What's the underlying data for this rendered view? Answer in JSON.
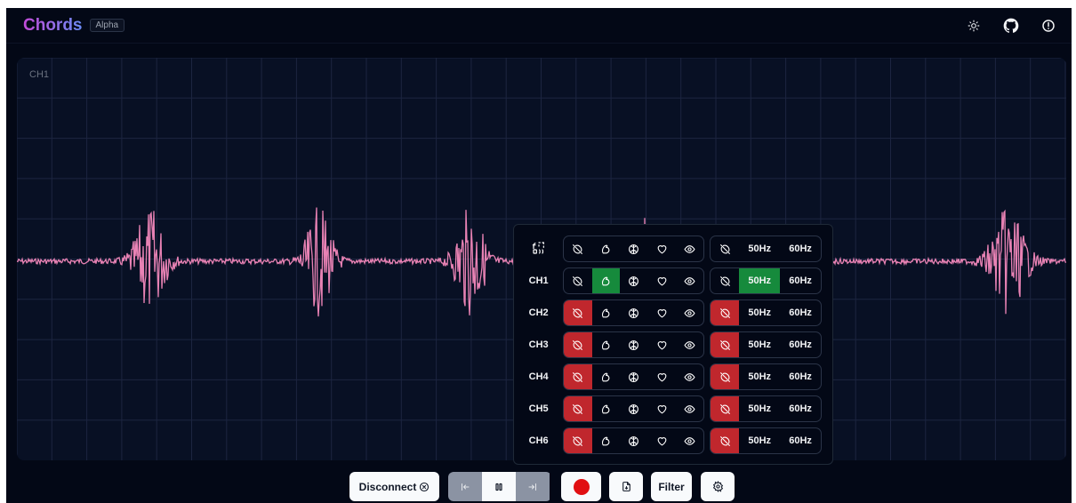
{
  "app": {
    "title": "Chords",
    "badge": "Alpha"
  },
  "header_icons": [
    "sun-icon",
    "github-icon",
    "info-icon"
  ],
  "plot": {
    "label": "CH1",
    "wave_color": "#e882b4",
    "grid_color": "#1c2540"
  },
  "panel": {
    "header_icon": "function-select-icon",
    "filter_icons": [
      "off-icon",
      "muscle-icon",
      "brain-icon",
      "heart-icon",
      "eye-icon"
    ],
    "notch_off_icon": "off-icon",
    "hz_labels": [
      "50Hz",
      "60Hz"
    ],
    "channels": [
      {
        "label": "CH1",
        "active_filter": 1,
        "notch_active": 1
      },
      {
        "label": "CH2",
        "active_filter": 0,
        "notch_active": 0
      },
      {
        "label": "CH3",
        "active_filter": 0,
        "notch_active": 0
      },
      {
        "label": "CH4",
        "active_filter": 0,
        "notch_active": 0
      },
      {
        "label": "CH5",
        "active_filter": 0,
        "notch_active": 0
      },
      {
        "label": "CH6",
        "active_filter": 0,
        "notch_active": 0
      }
    ],
    "colors": {
      "off": "#c0272d",
      "on": "#168a3c"
    }
  },
  "controls": {
    "disconnect_label": "Disconnect",
    "filter_label": "Filter"
  }
}
